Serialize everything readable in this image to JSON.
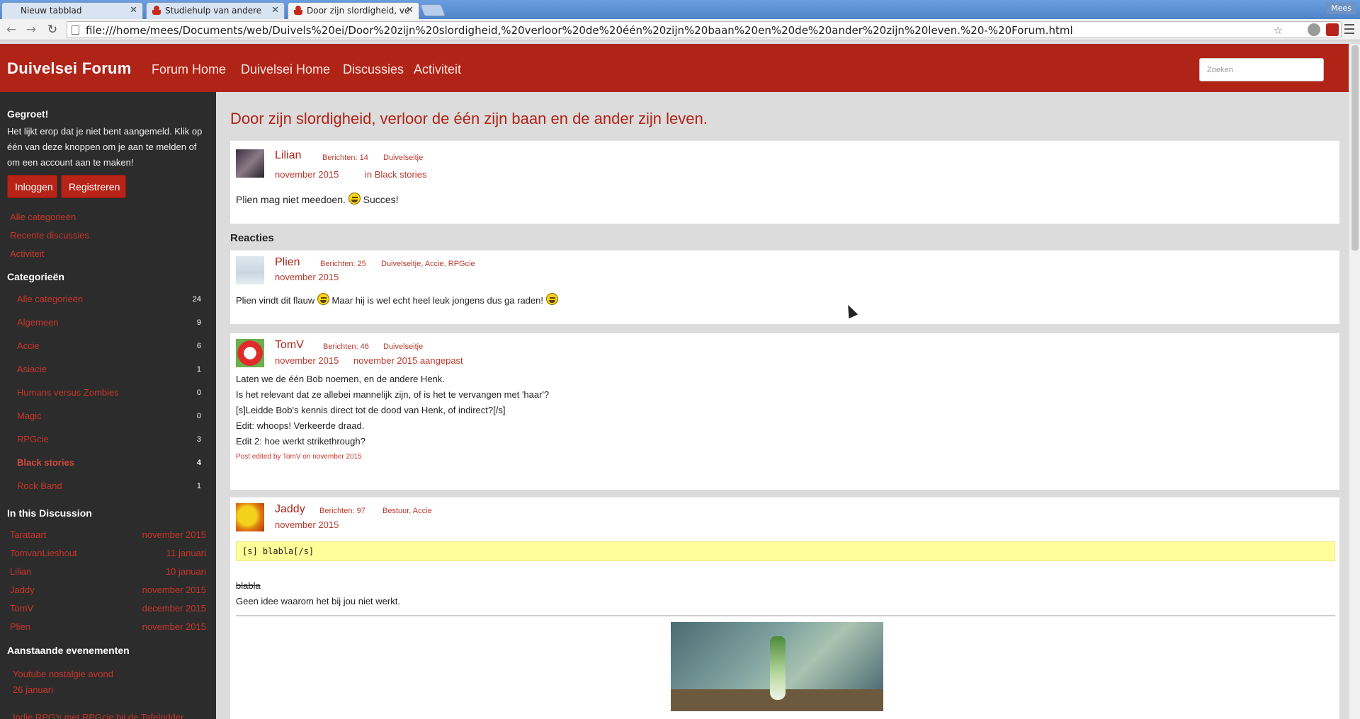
{
  "browser": {
    "tabs": [
      {
        "title": "Nieuw tabblad"
      },
      {
        "title": "Studiehulp van andere"
      },
      {
        "title": "Door zijn slordigheid, ve"
      }
    ],
    "user": "Mees",
    "url": "file:///home/mees/Documents/web/Duivels%20ei/Door%20zijn%20slordigheid,%20verloor%20de%20één%20zijn%20baan%20en%20de%20ander%20zijn%20leven.%20-%20Forum.html"
  },
  "header": {
    "brand": "Duivelsei Forum",
    "nav": [
      "Forum Home",
      "Duivelsei Home",
      "Discussies",
      "Activiteit"
    ],
    "search_placeholder": "Zoeken",
    "accent_color": "#b02418"
  },
  "sidebar": {
    "greeting_title": "Gegroet!",
    "greeting_text": "Het lijkt erop dat je niet bent aangemeld. Klik op één van deze knoppen om je aan te melden of om een account aan te maken!",
    "login_label": "Inloggen",
    "register_label": "Registreren",
    "links": [
      "Alle categorieën",
      "Recente discussies",
      "Activiteit"
    ],
    "categories_title": "Categorieën",
    "categories": [
      {
        "name": "Alle categorieën",
        "count": "24"
      },
      {
        "name": "Algemeen",
        "count": "9"
      },
      {
        "name": "Accie",
        "count": "6"
      },
      {
        "name": "Asiacie",
        "count": "1"
      },
      {
        "name": "Humans versus Zombies",
        "count": "0"
      },
      {
        "name": "Magic",
        "count": "0"
      },
      {
        "name": "RPGcie",
        "count": "3"
      },
      {
        "name": "Black stories",
        "count": "4"
      },
      {
        "name": "Rock Band",
        "count": "1"
      }
    ],
    "discussion_title": "In this Discussion",
    "participants": [
      {
        "name": "Tarataart",
        "date": "november 2015"
      },
      {
        "name": "TomvanLieshout",
        "date": "11 januari"
      },
      {
        "name": "Lilian",
        "date": "10 januari"
      },
      {
        "name": "Jaddy",
        "date": "november 2015"
      },
      {
        "name": "TomV",
        "date": "december 2015"
      },
      {
        "name": "Plien",
        "date": "november 2015"
      }
    ],
    "events_title": "Aanstaande evenementen",
    "events": [
      "Youtube nostalgie avond",
      "26 januari",
      "Indie RPG's met RPGcie bij de Tafelridder"
    ]
  },
  "main": {
    "title": "Door zijn slordigheid, verloor de één zijn baan en de ander zijn leven.",
    "op": {
      "author": "Lilian",
      "posts": "Berichten: 14",
      "role": "Duivelseitje",
      "date": "november 2015",
      "category": "in Black stories",
      "body_a": "Plien mag niet meedoen.",
      "body_b": "Succes!"
    },
    "reactions_title": "Reacties",
    "comments": [
      {
        "author": "Plien",
        "posts": "Berichten: 25",
        "role": "Duivelseitje, Accie, RPGcie",
        "date": "november 2015",
        "body_a": "Plien vindt dit flauw",
        "body_b": "Maar hij is wel echt heel leuk jongens dus ga raden!"
      },
      {
        "author": "TomV",
        "posts": "Berichten: 46",
        "role": "Duivelseitje",
        "date": "november 2015",
        "edited": "november 2015 aangepast",
        "lines": [
          "Laten we de één Bob noemen, en de andere Henk.",
          "Is het relevant dat ze allebei mannelijk zijn, of is het te vervangen met 'haar'?",
          "[s]Leidde Bob's kennis direct tot de dood van Henk, of indirect?[/s]",
          "Edit: whoops! Verkeerde draad.",
          "Edit 2: hoe werkt strikethrough?"
        ],
        "edit_note": "Post edited by TomV on november 2015"
      },
      {
        "author": "Jaddy",
        "posts": "Berichten: 97",
        "role": "Bestuur, Accie",
        "date": "november 2015",
        "code": "[s] blabla[/s]",
        "struck": "blabla",
        "line": "Geen idee waarom het bij jou niet werkt."
      }
    ]
  }
}
